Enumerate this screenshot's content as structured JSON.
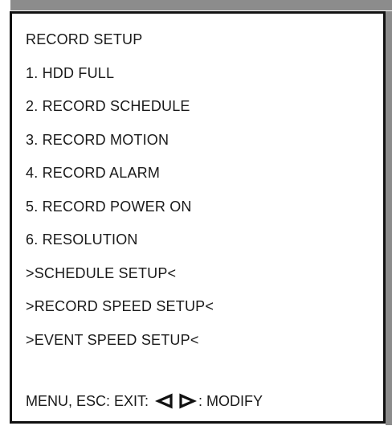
{
  "menu": {
    "title": "RECORD SETUP",
    "items": [
      {
        "label": "1. HDD FULL"
      },
      {
        "label": "2. RECORD SCHEDULE"
      },
      {
        "label": "3. RECORD MOTION"
      },
      {
        "label": "4. RECORD ALARM"
      },
      {
        "label": "5. RECORD POWER ON"
      },
      {
        "label": "6. RESOLUTION"
      }
    ],
    "submenus": [
      {
        "label": ">SCHEDULE SETUP<"
      },
      {
        "label": ">RECORD SPEED SETUP<"
      },
      {
        "label": ">EVENT SPEED SETUP<"
      }
    ],
    "footer": {
      "exit_text": "MENU, ESC: EXIT:",
      "left_arrow_icon": "left-triangle-outline",
      "right_arrow_icon": "right-triangle-outline",
      "modify_text": ": MODIFY"
    }
  },
  "colors": {
    "frame": "#111111",
    "shadow": "#8c8c8c",
    "background": "#ffffff"
  }
}
